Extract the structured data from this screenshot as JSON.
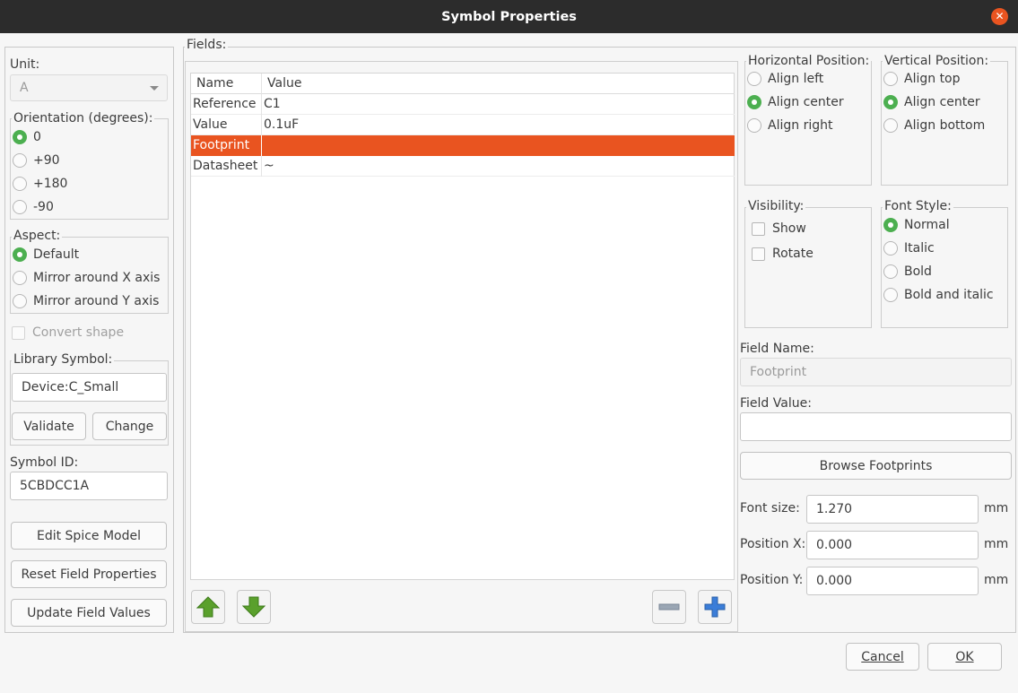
{
  "window": {
    "title": "Symbol Properties"
  },
  "unit": {
    "label": "Unit:",
    "value": "A"
  },
  "orientation": {
    "label": "Orientation (degrees):",
    "options": [
      "0",
      "+90",
      "+180",
      "-90"
    ],
    "selected": "0"
  },
  "aspect": {
    "label": "Aspect:",
    "options": [
      "Default",
      "Mirror around X axis",
      "Mirror around Y axis"
    ],
    "selected": "Default"
  },
  "convert_shape": {
    "label": "Convert shape"
  },
  "library_symbol": {
    "label": "Library Symbol:",
    "value": "Device:C_Small",
    "validate_label": "Validate",
    "change_label": "Change"
  },
  "symbol_id": {
    "label": "Symbol ID:",
    "value": "5CBDCC1A"
  },
  "buttons": {
    "edit_spice": "Edit Spice Model",
    "reset_fields": "Reset Field Properties",
    "update_fields": "Update Field Values",
    "cancel": "Cancel",
    "ok": "OK"
  },
  "fields": {
    "label": "Fields:",
    "columns": [
      "Name",
      "Value"
    ],
    "rows": [
      {
        "name": "Reference",
        "value": "C1"
      },
      {
        "name": "Value",
        "value": "0.1uF"
      },
      {
        "name": "Footprint",
        "value": ""
      },
      {
        "name": "Datasheet",
        "value": "~"
      }
    ],
    "selected_index": 2
  },
  "horizontal_position": {
    "label": "Horizontal Position:",
    "options": [
      "Align left",
      "Align center",
      "Align right"
    ],
    "selected": "Align center"
  },
  "vertical_position": {
    "label": "Vertical Position:",
    "options": [
      "Align top",
      "Align center",
      "Align bottom"
    ],
    "selected": "Align center"
  },
  "visibility": {
    "label": "Visibility:",
    "show": "Show",
    "rotate": "Rotate"
  },
  "font_style": {
    "label": "Font Style:",
    "options": [
      "Normal",
      "Italic",
      "Bold",
      "Bold and italic"
    ],
    "selected": "Normal"
  },
  "field_name": {
    "label": "Field Name:",
    "value": "Footprint"
  },
  "field_value": {
    "label": "Field Value:",
    "value": ""
  },
  "browse_footprints": "Browse Footprints",
  "font_size": {
    "label": "Font size:",
    "value": "1.270",
    "unit": "mm"
  },
  "position_x": {
    "label": "Position X:",
    "value": "0.000",
    "unit": "mm"
  },
  "position_y": {
    "label": "Position Y:",
    "value": "0.000",
    "unit": "mm"
  },
  "colors": {
    "accent": "#e95420",
    "radio_checked": "#4caf50",
    "arrow_green": "#5aa02c",
    "plus_blue": "#3b7dd8"
  }
}
